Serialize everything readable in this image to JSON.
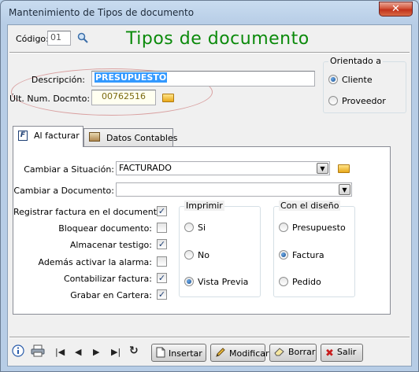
{
  "window": {
    "title": "Mantenimiento de Tipos de documento",
    "close_label": "✕"
  },
  "header": {
    "codigo_label": "Código:",
    "codigo_value": "01",
    "page_title": "Tipos de documento"
  },
  "form": {
    "descripcion_label": "Descripción:",
    "descripcion_value": "PRESUPUESTO",
    "ult_num_label": "Últ. Num. Docmto:",
    "ult_num_value": "00762516"
  },
  "orientado": {
    "title": "Orientado a",
    "options": [
      {
        "label": "Cliente",
        "selected": true
      },
      {
        "label": "Proveedor",
        "selected": false
      }
    ]
  },
  "tabs": [
    {
      "label": "Al facturar",
      "active": true,
      "icon": "form-icon"
    },
    {
      "label": "Datos Contables",
      "active": false,
      "icon": "ledger-icon"
    }
  ],
  "facturar": {
    "cambiar_situacion_label": "Cambiar a Situación:",
    "cambiar_situacion_value": "FACTURADO",
    "cambiar_documento_label": "Cambiar a Documento:",
    "cambiar_documento_value": "",
    "checks": [
      {
        "label": "Registrar factura en el documento:",
        "checked": true
      },
      {
        "label": "Bloquear documento:",
        "checked": false
      },
      {
        "label": "Almacenar testigo:",
        "checked": true
      },
      {
        "label": "Además activar la alarma:",
        "checked": false
      },
      {
        "label": "Contabilizar factura:",
        "checked": true
      },
      {
        "label": "Grabar en Cartera:",
        "checked": true
      }
    ],
    "imprimir": {
      "title": "Imprimir",
      "options": [
        {
          "label": "Si",
          "selected": false
        },
        {
          "label": "No",
          "selected": false
        },
        {
          "label": "Vista Previa",
          "selected": true
        }
      ]
    },
    "diseno": {
      "title": "Con el diseño",
      "options": [
        {
          "label": "Presupuesto",
          "selected": false
        },
        {
          "label": "Factura",
          "selected": true
        },
        {
          "label": "Pedido",
          "selected": false
        }
      ]
    }
  },
  "toolbar": {
    "nav": [
      "info-icon",
      "printer-icon",
      "first-icon",
      "prev-icon",
      "next-icon",
      "last-icon",
      "refresh-icon"
    ],
    "insertar_label": "Insertar",
    "modificar_label": "Modificar",
    "borrar_label": "Borrar",
    "salir_label": "Salir"
  },
  "colors": {
    "title_green": "#0b8a0b",
    "selection_blue": "#3399ff",
    "close_red": "#c2321b"
  }
}
